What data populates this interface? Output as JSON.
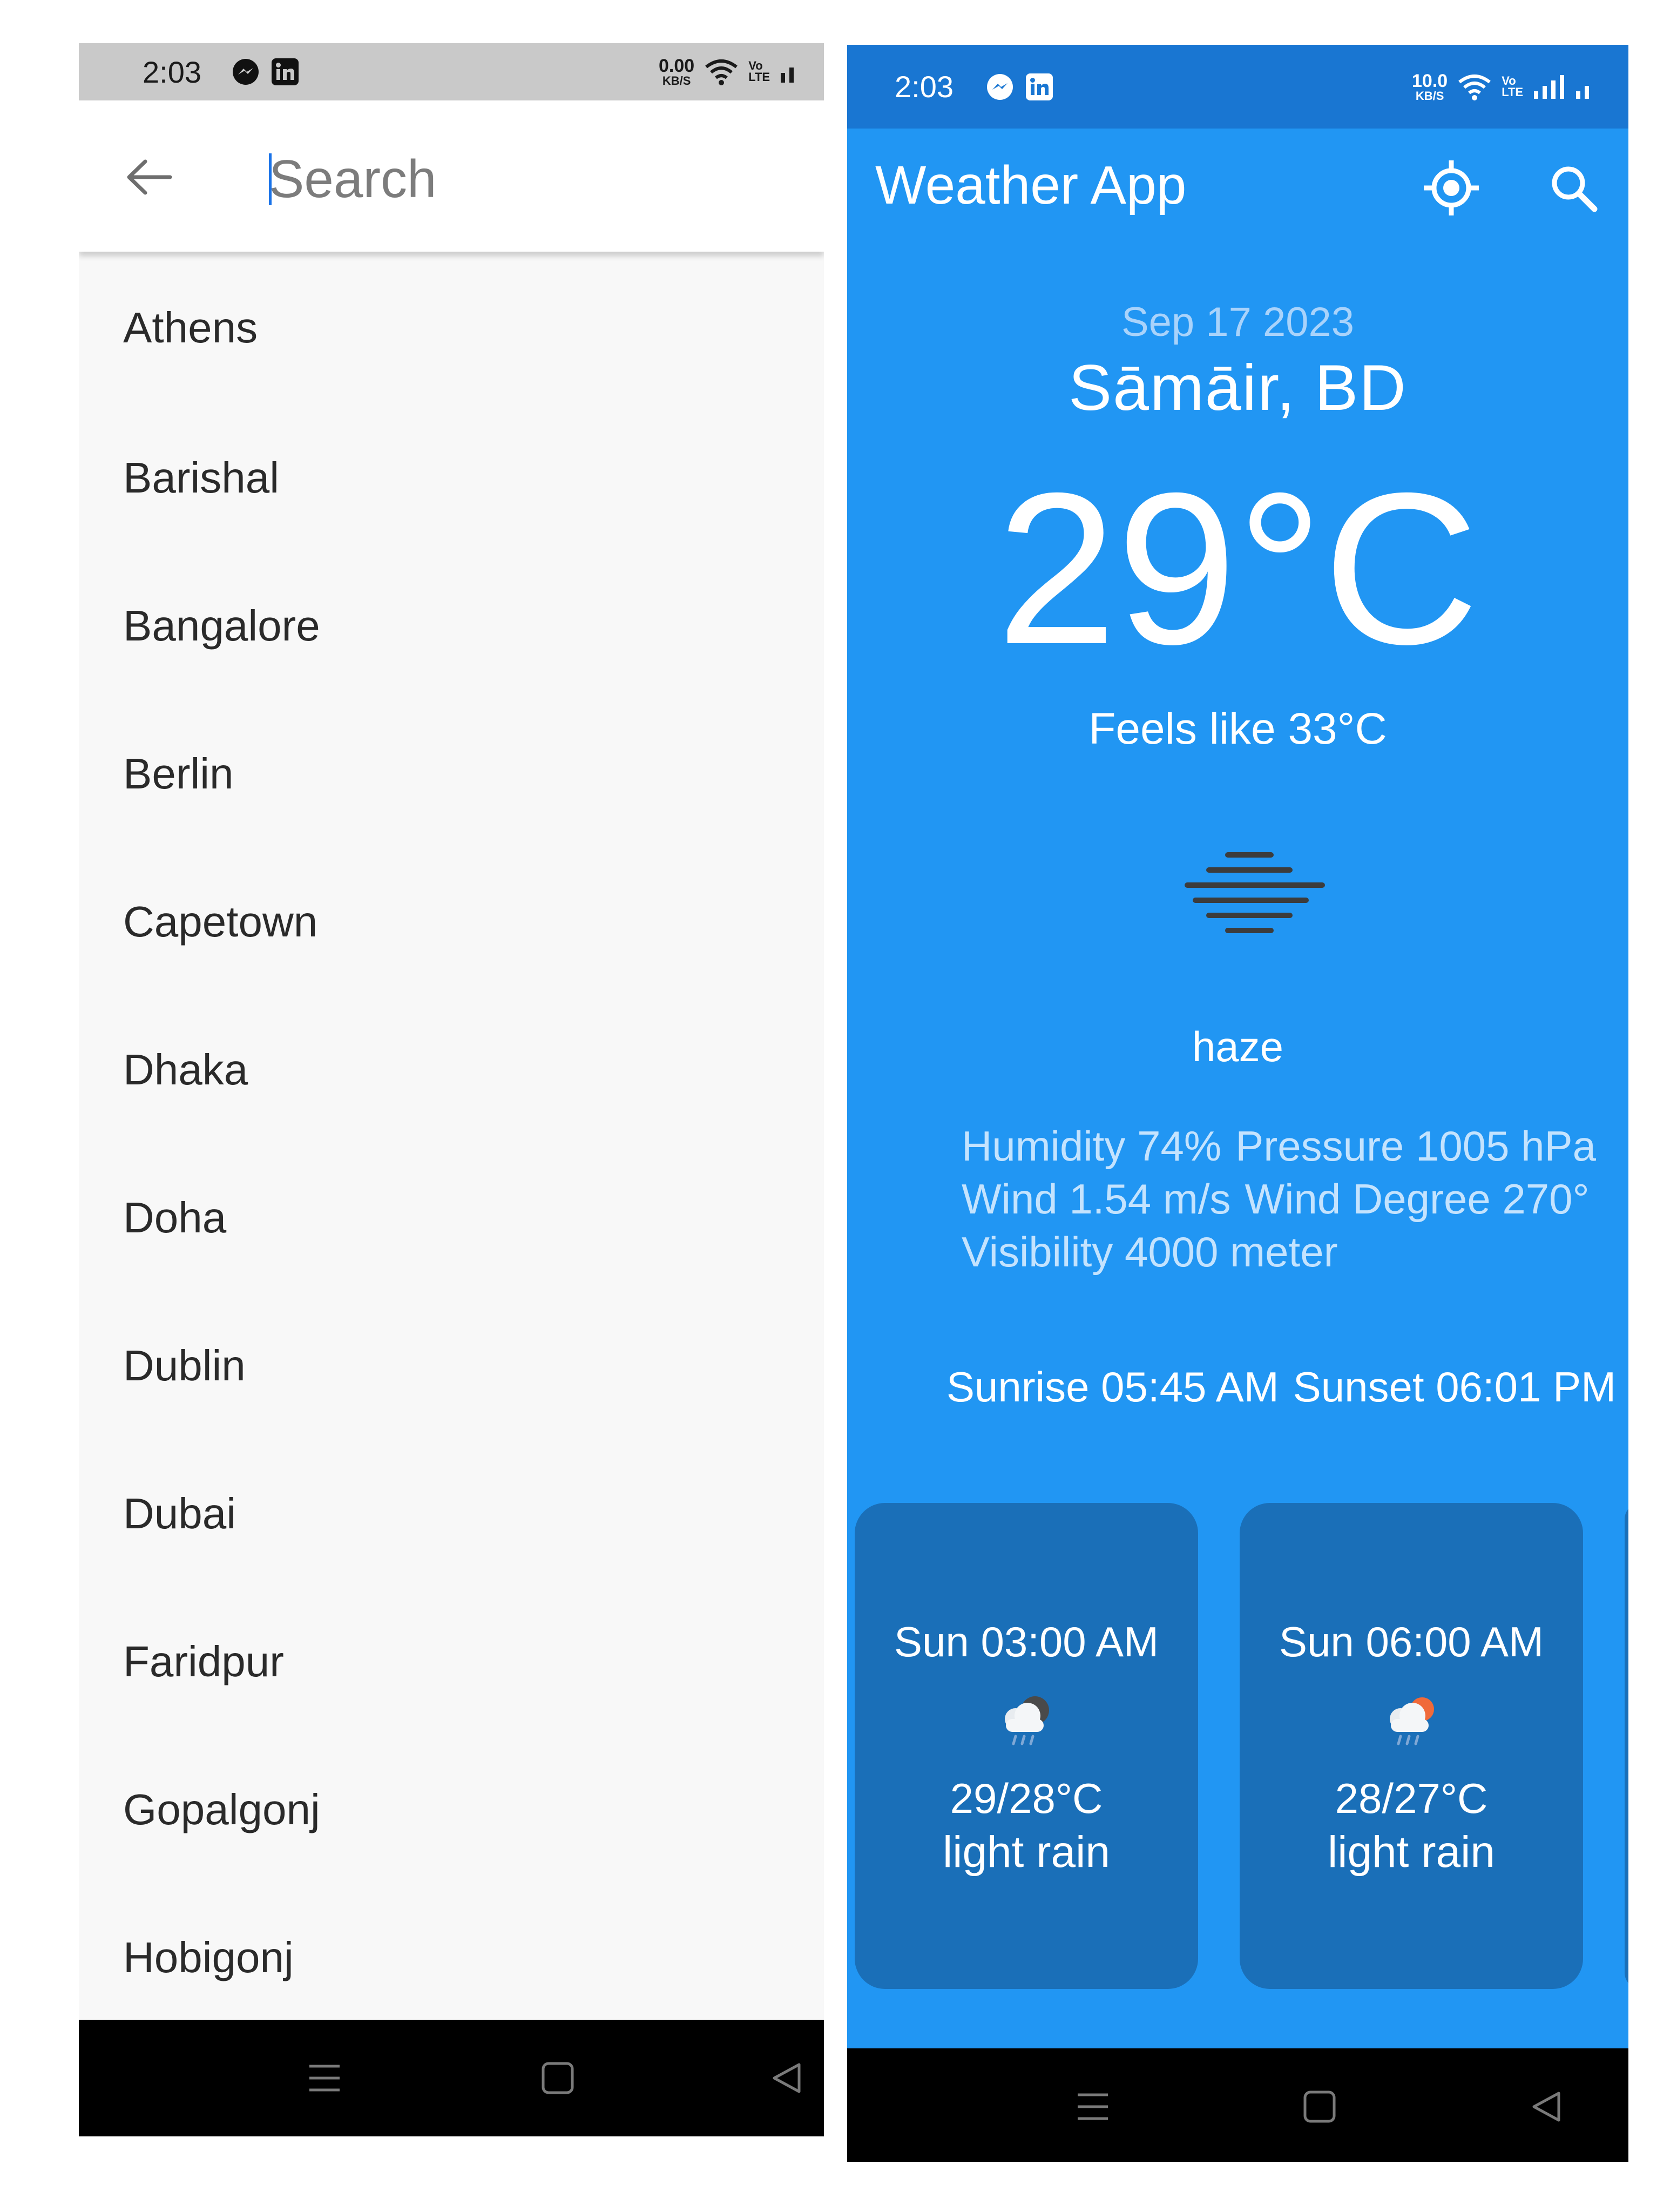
{
  "left_screen": {
    "status_bar": {
      "time": "2:03",
      "speed_value": "0.00",
      "speed_unit": "KB/S",
      "volte_top": "Vo",
      "volte_bottom": "LTE",
      "icons": [
        "messenger-icon",
        "linkedin-icon",
        "wifi-icon",
        "volte-icon",
        "signal-icon"
      ]
    },
    "search": {
      "placeholder": "Search",
      "back_icon": "arrow-back-icon"
    },
    "cities": [
      "Athens",
      "Barishal",
      "Bangalore",
      "Berlin",
      "Capetown",
      "Dhaka",
      "Doha",
      "Dublin",
      "Dubai",
      "Faridpur",
      "Gopalgonj",
      "Hobigonj"
    ],
    "nav_bar": {
      "icons": [
        "menu-icon",
        "home-icon",
        "back-icon"
      ]
    }
  },
  "right_screen": {
    "status_bar": {
      "time": "2:03",
      "speed_value": "10.0",
      "speed_unit": "KB/S",
      "volte_top": "Vo",
      "volte_bottom": "LTE",
      "icons": [
        "messenger-icon",
        "linkedin-icon",
        "wifi-icon",
        "volte-icon",
        "signal-icon"
      ]
    },
    "app_bar": {
      "title": "Weather App",
      "actions": [
        "my-location-icon",
        "search-icon"
      ]
    },
    "current": {
      "date": "Sep 17 2023",
      "location": "Sāmāir, BD",
      "temperature": "29°C",
      "feels_like": "Feels like 33°C",
      "icon": "haze-icon",
      "description": "haze"
    },
    "details": {
      "humidity": "Humidity 74%",
      "pressure": "Pressure 1005 hPa",
      "wind": "Wind 1.54 m/s",
      "wind_degree": "Wind Degree 270°",
      "visibility": "Visibility 4000 meter"
    },
    "sun": {
      "sunrise": "Sunrise 05:45 AM",
      "sunset": "Sunset 06:01 PM"
    },
    "forecast": [
      {
        "time": "Sun 03:00 AM",
        "temp": "29/28°C",
        "desc": "light rain",
        "icon": "rain-cloud-icon"
      },
      {
        "time": "Sun 06:00 AM",
        "temp": "28/27°C",
        "desc": "light rain",
        "icon": "rain-cloud-sun-icon"
      }
    ],
    "colors": {
      "primary": "#2196f3",
      "primary_dark": "#1976d2",
      "card": "#1a6fb8"
    },
    "nav_bar": {
      "icons": [
        "menu-icon",
        "home-icon",
        "back-icon"
      ]
    }
  }
}
